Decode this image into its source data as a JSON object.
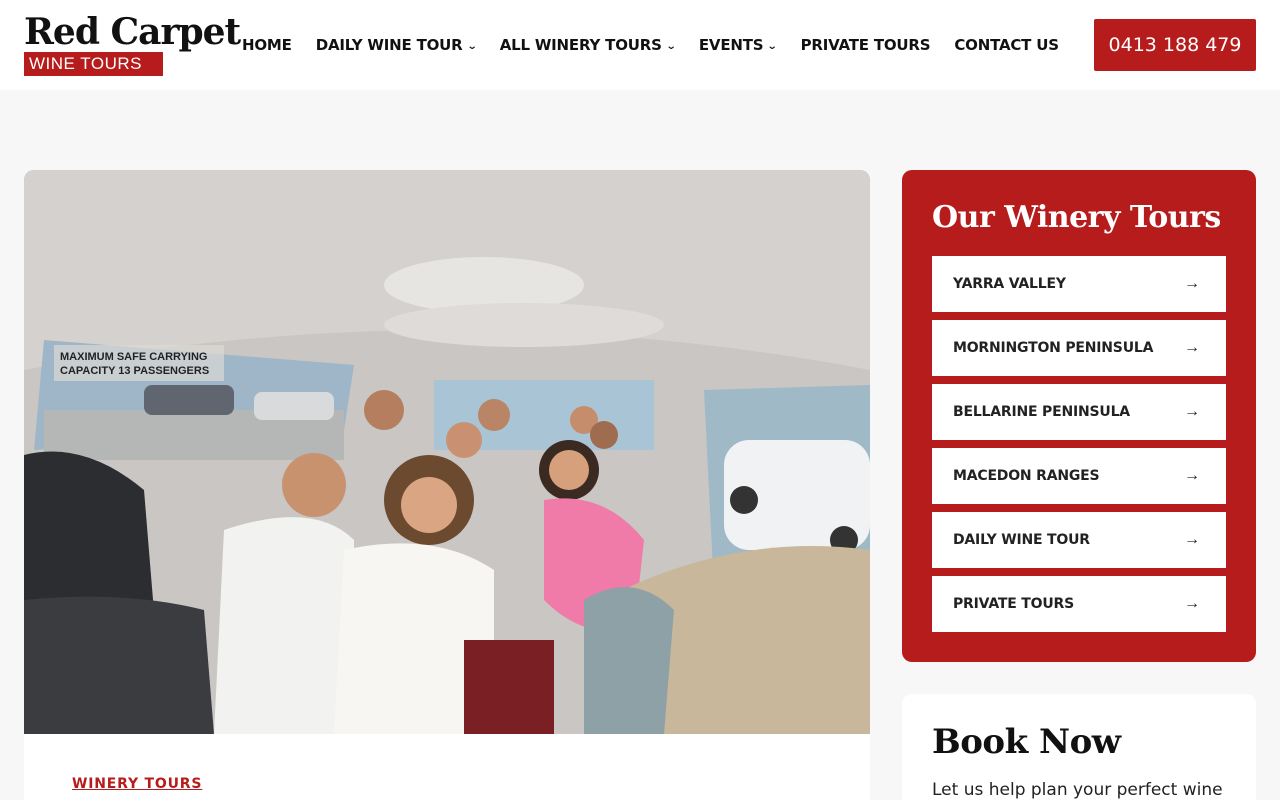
{
  "logo": {
    "line1": "Red Carpet",
    "line2": "WINE TOURS"
  },
  "nav": [
    {
      "label": "HOME",
      "dropdown": false
    },
    {
      "label": "DAILY WINE TOUR",
      "dropdown": true
    },
    {
      "label": "ALL WINERY TOURS",
      "dropdown": true
    },
    {
      "label": "EVENTS",
      "dropdown": true
    },
    {
      "label": "PRIVATE TOURS",
      "dropdown": false
    },
    {
      "label": "CONTACT US",
      "dropdown": false
    }
  ],
  "phone": "0413 188 479",
  "hero": {
    "sign_line1": "MAXIMUM SAFE CARRYING",
    "sign_line2": "CAPACITY 13 PASSENGERS"
  },
  "article": {
    "category": "WINERY TOURS"
  },
  "sidebar": {
    "tours_title": "Our Winery Tours",
    "tours": [
      {
        "label": "YARRA VALLEY",
        "icon": "arrow-right-icon"
      },
      {
        "label": "MORNINGTON PENINSULA",
        "icon": "arrow-right-icon"
      },
      {
        "label": "BELLARINE PENINSULA",
        "icon": "arrow-right-icon"
      },
      {
        "label": "MACEDON RANGES",
        "icon": "arrow-right-icon"
      },
      {
        "label": "DAILY WINE TOUR",
        "icon": "arrow-right-icon"
      },
      {
        "label": "PRIVATE TOURS",
        "icon": "arrow-right-icon"
      }
    ],
    "book_title": "Book Now",
    "book_text": "Let us help plan your perfect wine"
  },
  "colors": {
    "brand_red": "#b71c1c",
    "background": "#f7f7f7"
  }
}
